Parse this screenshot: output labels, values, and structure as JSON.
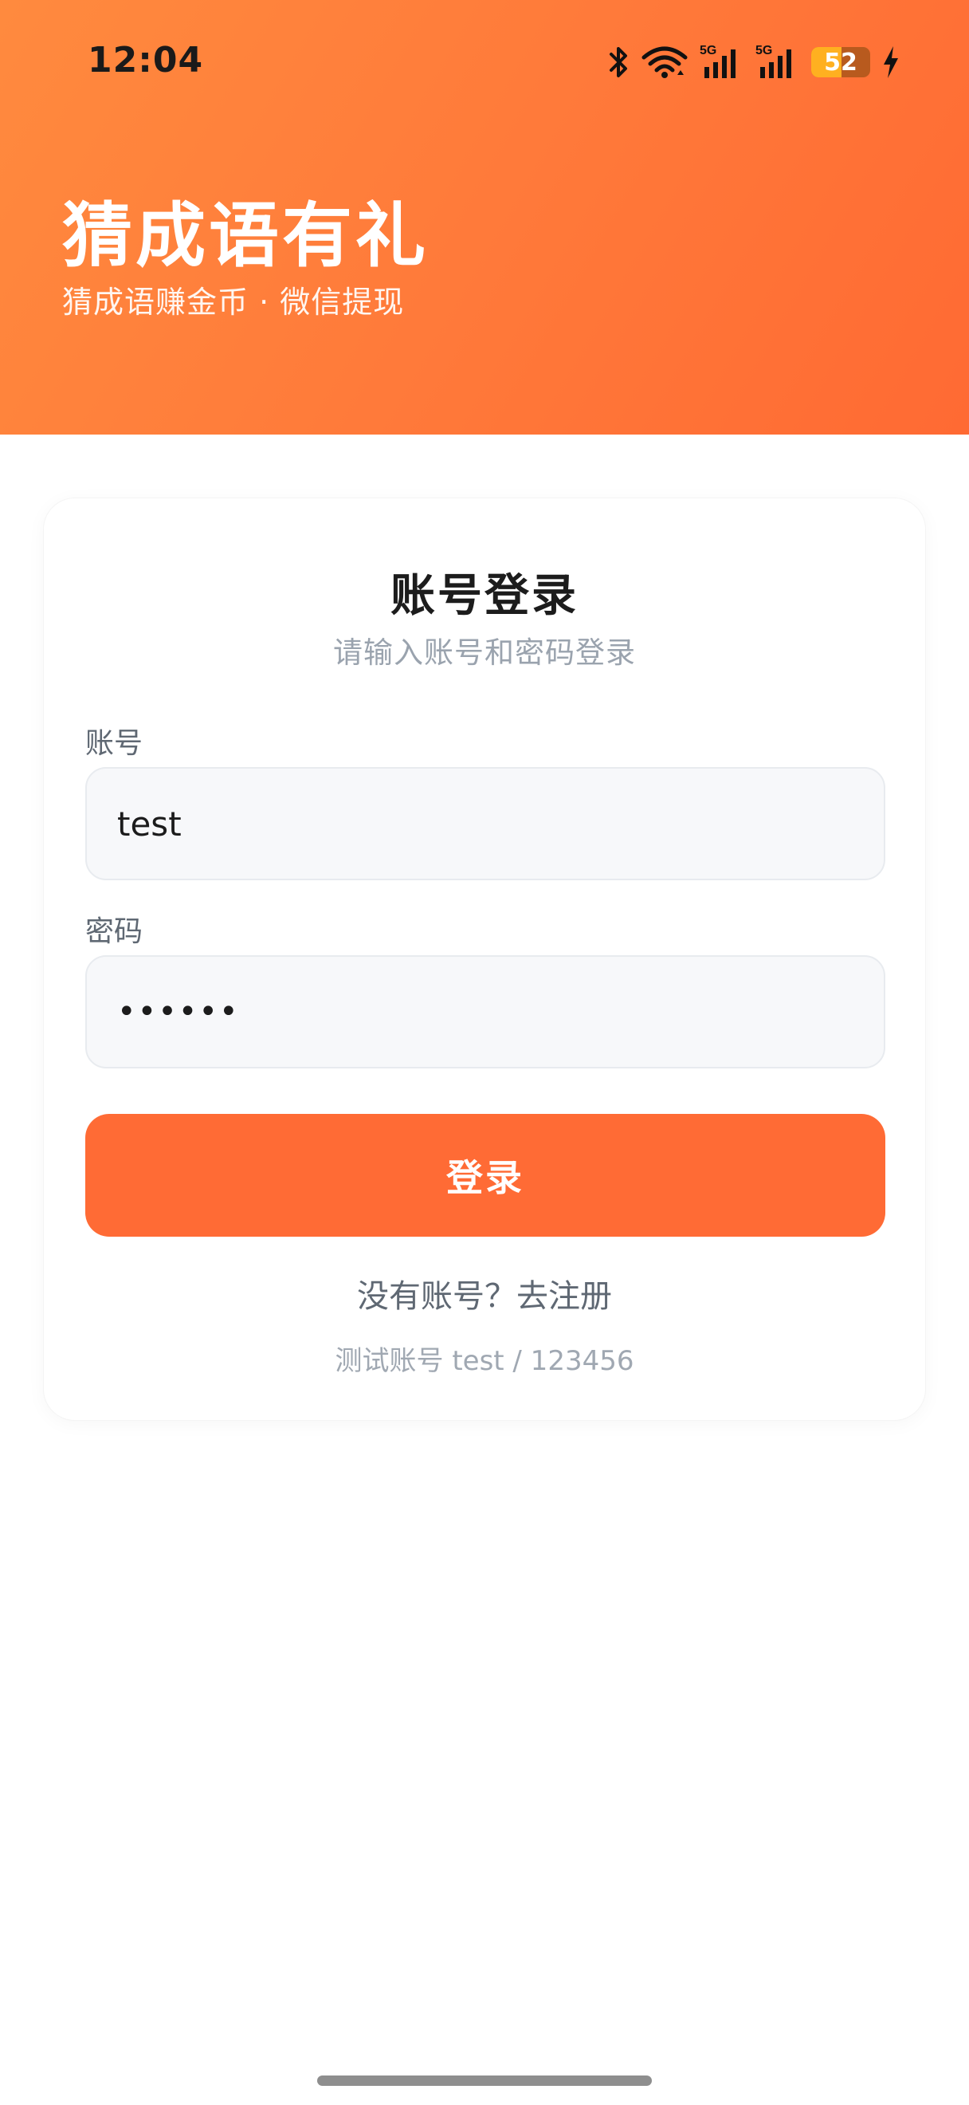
{
  "status_bar": {
    "time": "12:04",
    "network_labels": [
      "5G",
      "5G"
    ],
    "battery_level": 52,
    "battery_text": "52",
    "icons": [
      "bluetooth-icon",
      "wifi-icon",
      "signal-5g-icon",
      "signal-5g-icon",
      "battery-icon",
      "charging-icon"
    ]
  },
  "header": {
    "title": "猜成语有礼",
    "subtitle": "猜成语赚金币 · 微信提现",
    "gradient_colors": [
      "#ff8a3e",
      "#ff6a33"
    ]
  },
  "login_card": {
    "title": "账号登录",
    "subtitle": "请输入账号和密码登录",
    "account_label": "账号",
    "account_value": "test",
    "password_label": "密码",
    "password_value": "••••••",
    "submit_label": "登录",
    "register_link": "没有账号？去注册",
    "test_hint": "测试账号 test / 123456"
  },
  "colors": {
    "accent": "#ff6b35",
    "text_primary": "#1c1c1c",
    "text_secondary": "#9aa3ae",
    "input_background": "#f7f8fa"
  }
}
